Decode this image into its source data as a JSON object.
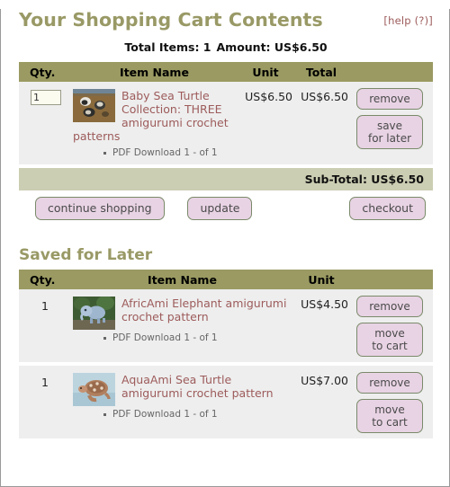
{
  "header": {
    "help_label": "[help (?)]",
    "title": "Your Shopping Cart Contents",
    "totals_items_label": "Total Items: 1",
    "totals_amount_label": "Amount: US$6.50"
  },
  "cart_table": {
    "columns": {
      "qty": "Qty.",
      "item_name": "Item Name",
      "unit": "Unit",
      "total": "Total",
      "actions": ""
    },
    "rows": [
      {
        "qty_value": "1",
        "thumb_name": "baby-sea-turtle-thumbnail",
        "item_name": "Baby Sea Turtle Collection: THREE amigurumi crochet patterns",
        "attributes": [
          "PDF Download 1 - of 1"
        ],
        "unit_price": "US$6.50",
        "total_price": "US$6.50",
        "remove_label": "remove",
        "save_label": "save\nfor later",
        "save_label_line1": "save",
        "save_label_line2": "for later"
      }
    ],
    "subtotal_label": "Sub-Total: US$6.50"
  },
  "cart_actions": {
    "continue_shopping": "continue shopping",
    "update": "update",
    "checkout": "checkout"
  },
  "saved_section": {
    "title": "Saved for Later",
    "columns": {
      "qty": "Qty.",
      "item_name": "Item Name",
      "unit": "Unit",
      "actions": ""
    },
    "rows": [
      {
        "qty_value": "1",
        "thumb_name": "africami-elephant-thumbnail",
        "item_name": "AfricAmi Elephant amigurumi crochet pattern",
        "attributes": [
          "PDF Download 1 - of 1"
        ],
        "unit_price": "US$4.50",
        "remove_label": "remove",
        "move_label_line1": "move",
        "move_label_line2": "to cart"
      },
      {
        "qty_value": "1",
        "thumb_name": "aquaami-sea-turtle-thumbnail",
        "item_name": "AquaAmi Sea Turtle amigurumi crochet pattern",
        "attributes": [
          "PDF Download 1 - of 1"
        ],
        "unit_price": "US$7.00",
        "remove_label": "remove",
        "move_label_line1": "move",
        "move_label_line2": "to cart"
      }
    ]
  },
  "colors": {
    "heading": "#999966",
    "table_header_band": "#9a9a62",
    "subtotal_band": "#ccceb3",
    "row_background": "#eeeeee",
    "link": "#9d5b5b",
    "button_face": "#e8d3e4",
    "button_border": "#7a8a6a"
  }
}
